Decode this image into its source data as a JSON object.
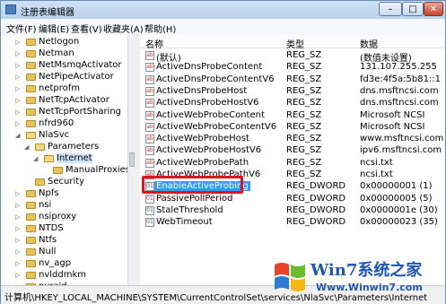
{
  "window": {
    "title": "注册表编辑器",
    "buttons": {
      "min": "–",
      "max": "□",
      "close": "✕"
    }
  },
  "menu": [
    "文件(F)",
    "编辑(E)",
    "查看(V)",
    "收藏夹(A)",
    "帮助(H)"
  ],
  "tree": [
    {
      "label": "Netlogon",
      "level": 3,
      "expander": "▷"
    },
    {
      "label": "Netman",
      "level": 3,
      "expander": "▷"
    },
    {
      "label": "NetMsmqActivator",
      "level": 3,
      "expander": "▷"
    },
    {
      "label": "NetPipeActivator",
      "level": 3,
      "expander": "▷"
    },
    {
      "label": "netprofm",
      "level": 3,
      "expander": "▷"
    },
    {
      "label": "NetTcpActivator",
      "level": 3,
      "expander": "▷"
    },
    {
      "label": "NetTcpPortSharing",
      "level": 3,
      "expander": "▷"
    },
    {
      "label": "nfrd960",
      "level": 3,
      "expander": "▷"
    },
    {
      "label": "NlaSvc",
      "level": 3,
      "expander": "◢",
      "open": true
    },
    {
      "label": "Parameters",
      "level": 4,
      "expander": "◢",
      "open": true
    },
    {
      "label": "Internet",
      "level": 5,
      "expander": "◢",
      "open": true,
      "selected": true
    },
    {
      "label": "ManualProxies",
      "level": 6,
      "expander": ""
    },
    {
      "label": "Security",
      "level": 4,
      "expander": ""
    },
    {
      "label": "Npfs",
      "level": 3,
      "expander": "▷"
    },
    {
      "label": "nsi",
      "level": 3,
      "expander": "▷"
    },
    {
      "label": "nsiproxy",
      "level": 3,
      "expander": "▷"
    },
    {
      "label": "NTDS",
      "level": 3,
      "expander": "▷"
    },
    {
      "label": "Ntfs",
      "level": 3,
      "expander": "▷"
    },
    {
      "label": "Null",
      "level": 3,
      "expander": "▷"
    },
    {
      "label": "nv_agp",
      "level": 3,
      "expander": "▷"
    },
    {
      "label": "nvlddmkm",
      "level": 3,
      "expander": "▷"
    },
    {
      "label": "nvraid",
      "level": 3,
      "expander": "▷"
    }
  ],
  "list": {
    "headers": {
      "name": "名称",
      "type": "类型",
      "data": "数据"
    },
    "rows": [
      {
        "icon": "ab",
        "name": "(默认)",
        "type": "REG_SZ",
        "data": "(数值未设置)"
      },
      {
        "icon": "ab",
        "name": "ActiveDnsProbeContent",
        "type": "REG_SZ",
        "data": "131.107.255.255"
      },
      {
        "icon": "ab",
        "name": "ActiveDnsProbeContentV6",
        "type": "REG_SZ",
        "data": "fd3e:4f5a:5b81::1"
      },
      {
        "icon": "ab",
        "name": "ActiveDnsProbeHost",
        "type": "REG_SZ",
        "data": "dns.msftncsi.com"
      },
      {
        "icon": "ab",
        "name": "ActiveDnsProbeHostV6",
        "type": "REG_SZ",
        "data": "dns.msftncsi.com"
      },
      {
        "icon": "ab",
        "name": "ActiveWebProbeContent",
        "type": "REG_SZ",
        "data": "Microsoft NCSI"
      },
      {
        "icon": "ab",
        "name": "ActiveWebProbeContentV6",
        "type": "REG_SZ",
        "data": "Microsoft NCSI"
      },
      {
        "icon": "ab",
        "name": "ActiveWebProbeHost",
        "type": "REG_SZ",
        "data": "www.msftncsi.com"
      },
      {
        "icon": "ab",
        "name": "ActiveWebProbeHostV6",
        "type": "REG_SZ",
        "data": "ipv6.msftncsi.com"
      },
      {
        "icon": "ab",
        "name": "ActiveWebProbePath",
        "type": "REG_SZ",
        "data": "ncsi.txt"
      },
      {
        "icon": "ab",
        "name": "ActiveWebProbePathV6",
        "type": "REG_SZ",
        "data": "ncsi.txt"
      },
      {
        "icon": "01",
        "name": "EnableActiveProbing",
        "type": "REG_DWORD",
        "data": "0x00000001 (1)",
        "highlight": true
      },
      {
        "icon": "01",
        "name": "PassivePollPeriod",
        "type": "REG_DWORD",
        "data": "0x00000005 (5)"
      },
      {
        "icon": "01",
        "name": "StaleThreshold",
        "type": "REG_DWORD",
        "data": "0x0000001e (30)"
      },
      {
        "icon": "01",
        "name": "WebTimeout",
        "type": "REG_DWORD",
        "data": "0x00000023 (35)"
      }
    ]
  },
  "statusbar": "计算机\\HKEY_LOCAL_MACHINE\\SYSTEM\\CurrentControlSet\\services\\NlaSvc\\Parameters\\Internet",
  "watermark": {
    "main": "Win7系统之家",
    "url": "Www.Winwin7.com"
  }
}
